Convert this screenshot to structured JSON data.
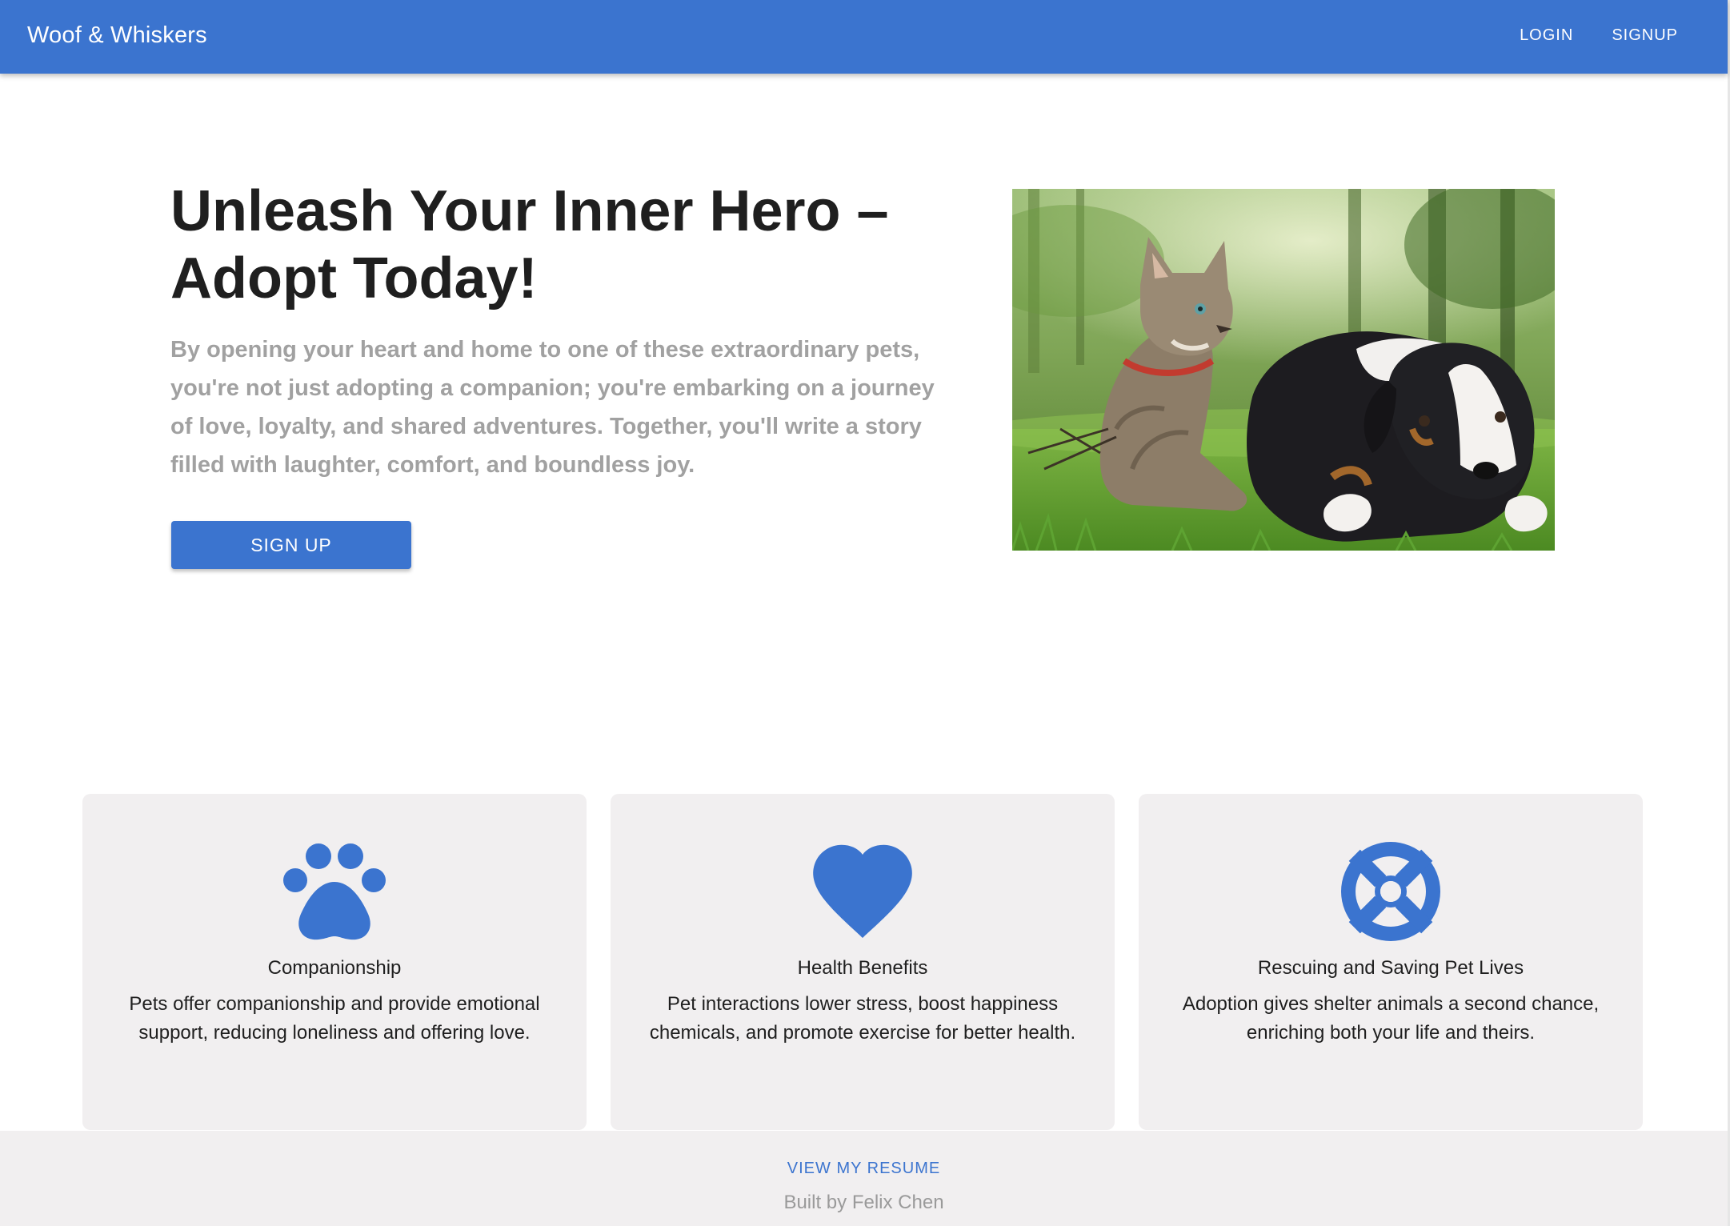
{
  "header": {
    "brand": "Woof & Whiskers",
    "nav": [
      {
        "label": "LOGIN",
        "icon": ""
      },
      {
        "label": "SIGNUP",
        "icon": ""
      }
    ]
  },
  "hero": {
    "title": "Unleash Your Inner Hero – Adopt Today!",
    "description": "By opening your heart and home to one of these extraordinary pets, you're not just adopting a companion; you're embarking on a journey of love, loyalty, and shared adventures. Together, you'll write a story filled with laughter, comfort, and boundless joy.",
    "cta_label": "SIGN UP",
    "image_icon": "cat-and-dog-photo"
  },
  "features": [
    {
      "icon": "paw-icon",
      "title": "Companionship",
      "text": "Pets offer companionship and provide emotional support, reducing loneliness and offering love."
    },
    {
      "icon": "heart-icon",
      "title": "Health Benefits",
      "text": "Pet interactions lower stress, boost happiness chemicals, and promote exercise for better health."
    },
    {
      "icon": "lifebuoy-icon",
      "title": "Rescuing and Saving Pet Lives",
      "text": "Adoption gives shelter animals a second chance, enriching both your life and theirs."
    }
  ],
  "footer": {
    "resume_label": "VIEW MY RESUME",
    "built_by": "Built by Felix Chen"
  },
  "colors": {
    "primary": "#3b74cf",
    "card_bg": "#f1eff0",
    "muted_text": "#a1a1a1",
    "heading": "#1f1f1f"
  }
}
